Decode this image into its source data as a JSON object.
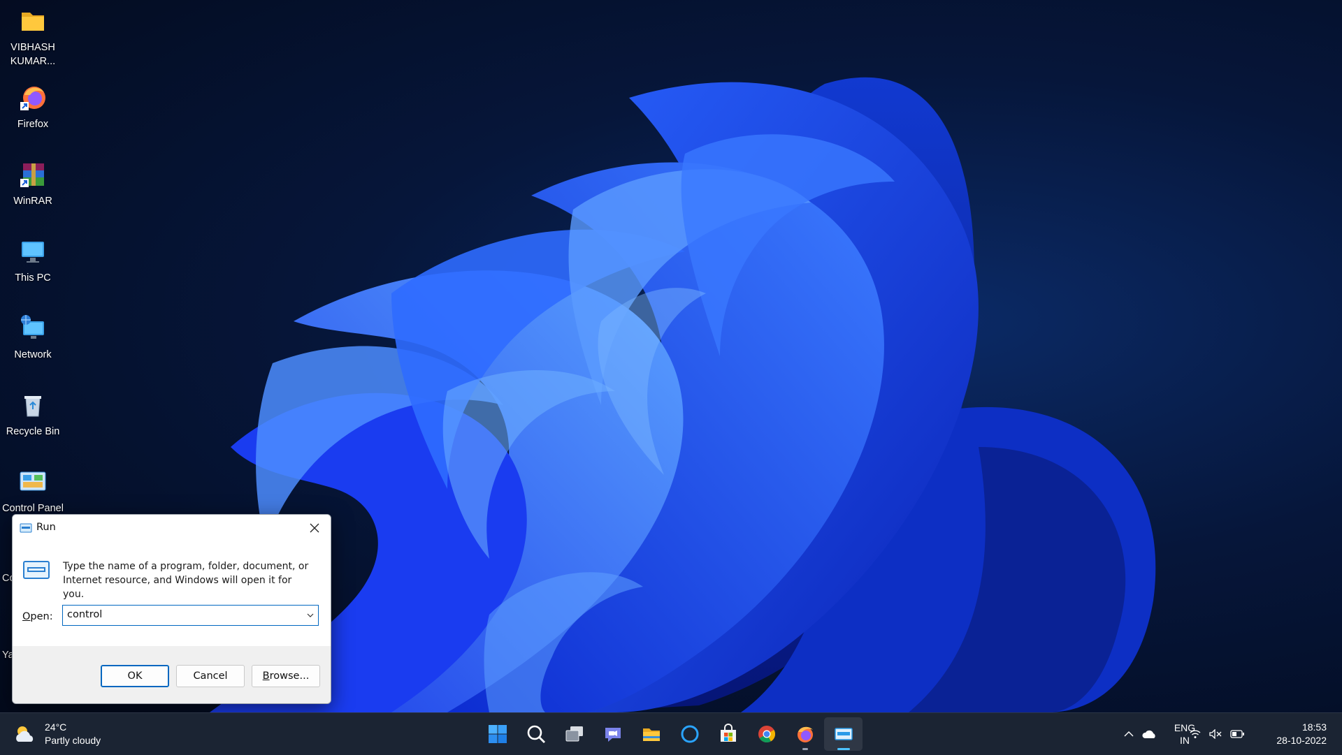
{
  "desktop_icons": [
    {
      "label": "VIBHASH KUMAR...",
      "icon": "folder-icon"
    },
    {
      "label": "Firefox",
      "icon": "firefox-shortcut-icon"
    },
    {
      "label": "WinRAR",
      "icon": "winrar-shortcut-icon"
    },
    {
      "label": "This PC",
      "icon": "this-pc-icon"
    },
    {
      "label": "Network",
      "icon": "network-icon"
    },
    {
      "label": "Recycle Bin",
      "icon": "recycle-bin-icon"
    },
    {
      "label": "Control Panel",
      "icon": "control-panel-icon"
    }
  ],
  "partial_labels": [
    "Co",
    "Ya"
  ],
  "run_dialog": {
    "title": "Run",
    "description": "Type the name of a program, folder, document, or Internet resource, and Windows will open it for you.",
    "open_label_prefix": "O",
    "open_label_rest": "pen:",
    "open_value": "control",
    "ok_label": "OK",
    "cancel_label": "Cancel",
    "browse_label_prefix": "B",
    "browse_label_rest": "rowse..."
  },
  "taskbar": {
    "weather_temp": "24°C",
    "weather_desc": "Partly cloudy",
    "apps": [
      {
        "name": "start-button",
        "icon": "windows-logo-icon"
      },
      {
        "name": "search-button",
        "icon": "search-icon"
      },
      {
        "name": "task-view-button",
        "icon": "task-view-icon"
      },
      {
        "name": "chat-button",
        "icon": "teams-chat-icon"
      },
      {
        "name": "file-explorer-button",
        "icon": "folder-icon"
      },
      {
        "name": "cortana-button",
        "icon": "cortana-icon"
      },
      {
        "name": "microsoft-store-button",
        "icon": "store-icon"
      },
      {
        "name": "chrome-button",
        "icon": "chrome-icon"
      },
      {
        "name": "firefox-button",
        "icon": "firefox-icon"
      },
      {
        "name": "run-taskbar-button",
        "icon": "run-icon"
      }
    ],
    "lang_primary": "ENG",
    "lang_secondary": "IN",
    "time": "18:53",
    "date": "28-10-2022"
  },
  "colors": {
    "accent": "#0067c0",
    "taskbar": "#1b2433",
    "wallpaper_bloom": "#1f4dff"
  }
}
